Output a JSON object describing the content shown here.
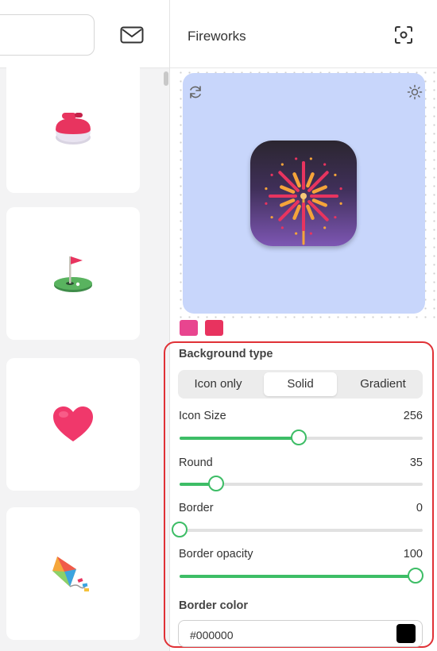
{
  "window": {
    "title": "Fireworks"
  },
  "left_panel": {
    "search": {
      "value": "",
      "placeholder": ""
    },
    "mail_icon": "envelope-icon",
    "cards": [
      {
        "icon": "curling-stone-icon"
      },
      {
        "icon": "flag-in-hole-icon"
      },
      {
        "icon": "red-heart-icon"
      },
      {
        "icon": "kite-icon"
      }
    ]
  },
  "preview": {
    "background_color": "#c8d6fb",
    "icon": "fireworks-icon",
    "refresh_icon": "refresh-icon",
    "theme_icon": "sun-icon",
    "swatches": [
      "#e8458f",
      "#e8335f"
    ]
  },
  "settings": {
    "background_type": {
      "label": "Background type",
      "options": [
        "Icon only",
        "Solid",
        "Gradient"
      ],
      "selected": "Solid"
    },
    "icon_size": {
      "label": "Icon Size",
      "value": "256",
      "fraction": 0.49
    },
    "round": {
      "label": "Round",
      "value": "35",
      "fraction": 0.15
    },
    "border": {
      "label": "Border",
      "value": "0",
      "fraction": 0.0
    },
    "border_opacity": {
      "label": "Border opacity",
      "value": "100",
      "fraction": 0.97
    },
    "border_color": {
      "label": "Border color",
      "value": "#000000",
      "swatch": "#000000"
    }
  },
  "colors": {
    "accent": "#3dbd66",
    "highlight_outline": "#e03136"
  }
}
